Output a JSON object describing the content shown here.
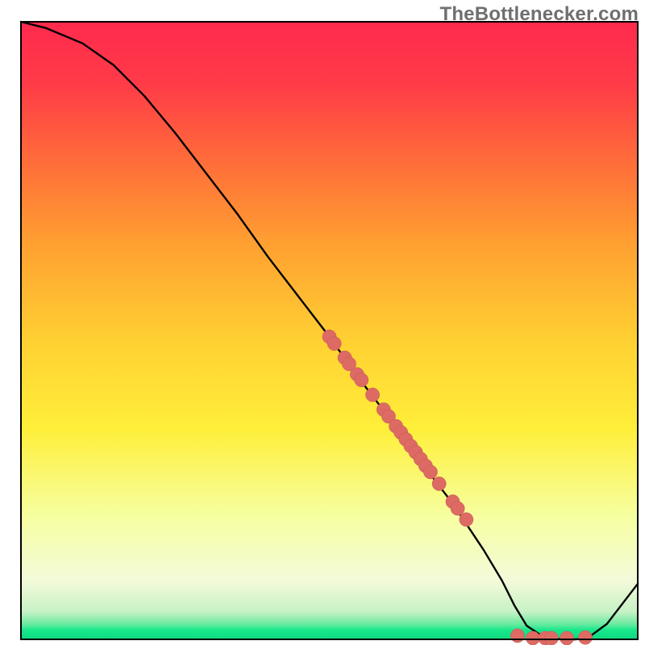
{
  "watermark": "TheBottlenecker.com",
  "colors": {
    "gradient_top": "#ff2a4d",
    "gradient_yellow_top": "#ffef3a",
    "gradient_yellow_bot": "#f6ffa0",
    "gradient_cream": "#f3fada",
    "gradient_green": "#17e88b",
    "curve": "#000000",
    "dot_fill": "#dd6a63",
    "dot_stroke": "#c25a55",
    "plot_border": "#000000"
  },
  "chart_data": {
    "type": "line",
    "title": "",
    "xlabel": "",
    "ylabel": "",
    "xlim": [
      0,
      100
    ],
    "ylim": [
      0,
      100
    ],
    "grid": false,
    "curve": {
      "x": [
        0,
        4,
        10,
        15,
        20,
        25,
        30,
        35,
        40,
        45,
        50,
        55,
        60,
        65,
        70,
        75,
        78,
        80,
        82,
        85,
        88,
        90,
        92,
        95,
        100
      ],
      "y": [
        100,
        99,
        96.5,
        93,
        88,
        82,
        75.5,
        69,
        62,
        55.5,
        49,
        42,
        35.5,
        28.5,
        22,
        14.5,
        9.5,
        5.5,
        2.2,
        0.2,
        0,
        0,
        0.3,
        2.5,
        9
      ]
    },
    "series": [
      {
        "name": "diagonal_clusters",
        "x": [
          50,
          50.8,
          52.5,
          53.2,
          54.5,
          55.2,
          57,
          58.8,
          59.6,
          60.8,
          61.6,
          62.4,
          63.2,
          64,
          64.8,
          65.6,
          66.4,
          67.8,
          70,
          70.8,
          72.2
        ],
        "y": [
          49,
          47.9,
          45.6,
          44.6,
          42.9,
          42,
          39.6,
          37.2,
          36.1,
          34.5,
          33.5,
          32.4,
          31.3,
          30.3,
          29.2,
          28.1,
          27.1,
          25.2,
          22.3,
          21.2,
          19.4
        ]
      },
      {
        "name": "bottom_points",
        "x": [
          80.5,
          83,
          85,
          86,
          88.5,
          91.5
        ],
        "y": [
          0.6,
          0.2,
          0.2,
          0.2,
          0.2,
          0.3
        ]
      }
    ]
  }
}
